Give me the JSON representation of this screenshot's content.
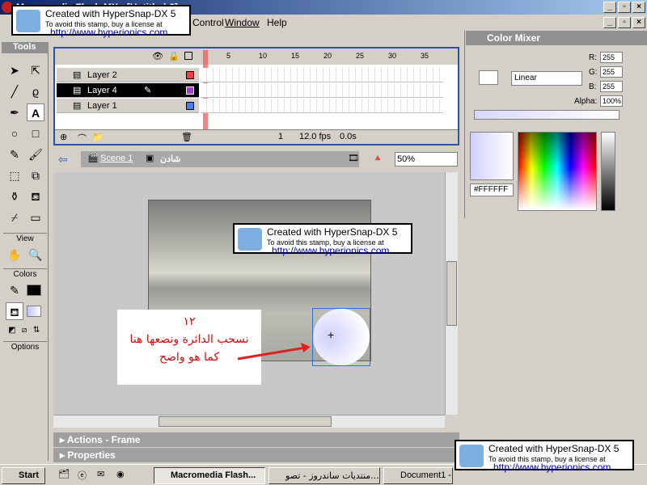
{
  "window": {
    "title": "Macromedia Flash MX - [Untitled-2]"
  },
  "menu": [
    "Control",
    "Window",
    "Help"
  ],
  "tools": {
    "title": "Tools",
    "view_label": "View",
    "colors_label": "Colors",
    "options_label": "Options"
  },
  "timeline": {
    "frame_ticks": [
      "5",
      "10",
      "15",
      "20",
      "25",
      "30",
      "35"
    ],
    "layers": [
      {
        "name": "Layer 2",
        "color": "#f04040",
        "selected": false
      },
      {
        "name": "Layer 4",
        "color": "#a040c0",
        "selected": true
      },
      {
        "name": "Layer 1",
        "color": "#4080f0",
        "selected": false
      }
    ],
    "current_frame": "1",
    "fps": "12.0 fps",
    "time": "0.0s"
  },
  "editbar": {
    "scene": "Scene 1",
    "symbol": "شادن",
    "zoom": "50%"
  },
  "panels": {
    "actions": "Actions - Frame",
    "properties": "Properties"
  },
  "color_mixer": {
    "title": "Color Mixer",
    "fill_type": "Linear",
    "r": "255",
    "g": "255",
    "b": "255",
    "alpha": "100%",
    "hex": "#FFFFFF",
    "r_label": "R:",
    "g_label": "G:",
    "b_label": "B:",
    "alpha_label": "Alpha:"
  },
  "annotation": {
    "number": "١٢",
    "line1": "نسحب الدائرة ونضعها هنا",
    "line2": "كما هو واضح"
  },
  "stamp": {
    "line1": "Created with HyperSnap-DX 5",
    "line2": "To avoid this stamp, buy a license at",
    "line3": "http://www.hyperionics.com"
  },
  "taskbar": {
    "start": "Start",
    "items": [
      "Macromedia Flash...",
      "منتديات ساندروز - تصو...",
      "Document1 -"
    ]
  },
  "colors": {
    "accent": "#0a246a",
    "annotation_text": "#d01010",
    "arrow": "#e02020"
  }
}
